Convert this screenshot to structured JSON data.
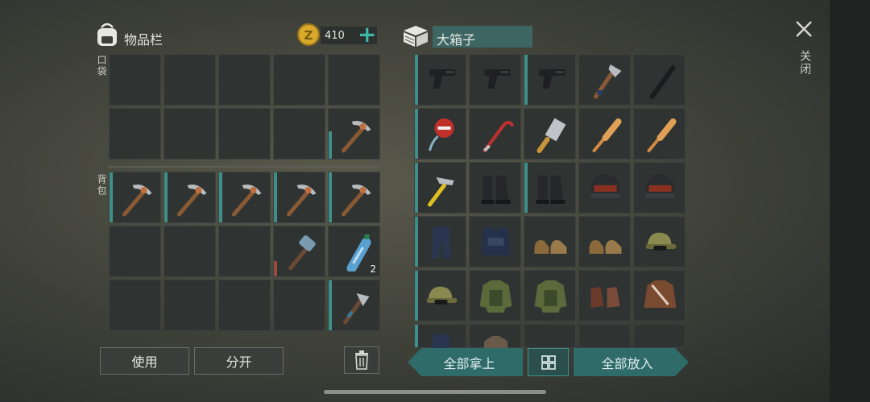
{
  "inventory": {
    "title": "物品栏",
    "coins": "410",
    "pocket_label": "口袋",
    "backpack_label": "背包",
    "pocket_slots": [
      {
        "item": "",
        "qty": "",
        "dur": ""
      },
      {
        "item": "",
        "qty": "",
        "dur": ""
      },
      {
        "item": "",
        "qty": "",
        "dur": ""
      },
      {
        "item": "",
        "qty": "",
        "dur": ""
      },
      {
        "item": "",
        "qty": "",
        "dur": ""
      },
      {
        "item": "",
        "qty": "",
        "dur": ""
      },
      {
        "item": "",
        "qty": "",
        "dur": ""
      },
      {
        "item": "",
        "qty": "",
        "dur": ""
      },
      {
        "item": "",
        "qty": "",
        "dur": ""
      },
      {
        "item": "pickaxe",
        "qty": "",
        "dur": "half"
      }
    ],
    "backpack_slots": [
      {
        "item": "pickaxe",
        "qty": "",
        "dur": "full"
      },
      {
        "item": "pickaxe",
        "qty": "",
        "dur": "full"
      },
      {
        "item": "pickaxe",
        "qty": "",
        "dur": "full"
      },
      {
        "item": "pickaxe",
        "qty": "",
        "dur": "full"
      },
      {
        "item": "pickaxe",
        "qty": "",
        "dur": "full"
      },
      {
        "item": "",
        "qty": "",
        "dur": ""
      },
      {
        "item": "",
        "qty": "",
        "dur": ""
      },
      {
        "item": "",
        "qty": "",
        "dur": ""
      },
      {
        "item": "hammer",
        "qty": "",
        "dur": "low"
      },
      {
        "item": "water-bottle",
        "qty": "2",
        "dur": ""
      },
      {
        "item": "",
        "qty": "",
        "dur": ""
      },
      {
        "item": "",
        "qty": "",
        "dur": ""
      },
      {
        "item": "",
        "qty": "",
        "dur": ""
      },
      {
        "item": "",
        "qty": "",
        "dur": ""
      },
      {
        "item": "hatchet",
        "qty": "",
        "dur": "full"
      }
    ],
    "use_label": "使用",
    "split_label": "分开"
  },
  "box": {
    "title": "大箱子",
    "slots": [
      {
        "item": "pistol",
        "dur": "full"
      },
      {
        "item": "pistol",
        "dur": ""
      },
      {
        "item": "pistol",
        "dur": "full"
      },
      {
        "item": "axe",
        "dur": ""
      },
      {
        "item": "nightstick",
        "dur": ""
      },
      {
        "item": "stop-sign",
        "dur": "full"
      },
      {
        "item": "crowbar",
        "dur": ""
      },
      {
        "item": "cleaver",
        "dur": ""
      },
      {
        "item": "bat",
        "dur": ""
      },
      {
        "item": "bat",
        "dur": ""
      },
      {
        "item": "claw-hammer",
        "dur": "full"
      },
      {
        "item": "boots",
        "dur": ""
      },
      {
        "item": "boots",
        "dur": "full"
      },
      {
        "item": "helmet",
        "dur": ""
      },
      {
        "item": "helmet",
        "dur": ""
      },
      {
        "item": "pants",
        "dur": "full"
      },
      {
        "item": "vest",
        "dur": ""
      },
      {
        "item": "shoes",
        "dur": ""
      },
      {
        "item": "shoes",
        "dur": ""
      },
      {
        "item": "cap",
        "dur": ""
      },
      {
        "item": "cap",
        "dur": "full"
      },
      {
        "item": "camo-jacket",
        "dur": ""
      },
      {
        "item": "camo-jacket",
        "dur": ""
      },
      {
        "item": "leather-boots",
        "dur": ""
      },
      {
        "item": "leather-jacket",
        "dur": ""
      },
      {
        "item": "pants",
        "dur": "full"
      },
      {
        "item": "jacket",
        "dur": ""
      },
      {
        "item": "",
        "dur": ""
      },
      {
        "item": "",
        "dur": ""
      },
      {
        "item": "",
        "dur": ""
      }
    ],
    "take_all_label": "全部拿上",
    "put_all_label": "全部放入"
  },
  "close_label": "关闭"
}
